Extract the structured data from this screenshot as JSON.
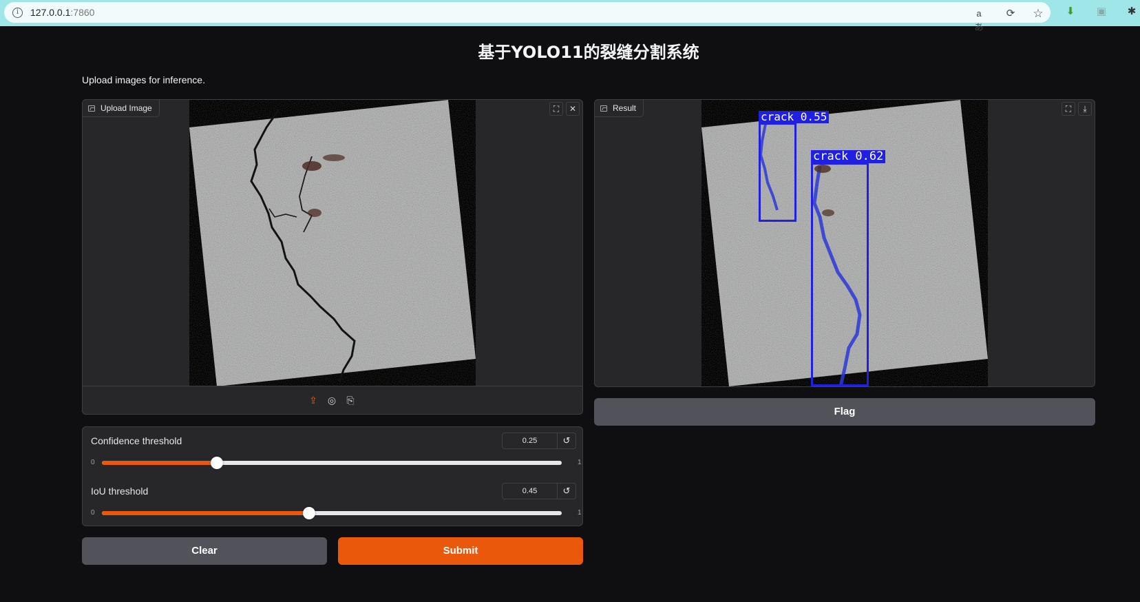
{
  "browser": {
    "url_host": "127.0.0.1",
    "url_port": ":7860",
    "icons": [
      "read-aloud-icon",
      "refresh-icon",
      "favorite-star-icon",
      "extension-download-icon",
      "extension-screen-icon",
      "extensions-puzzle-icon"
    ]
  },
  "page": {
    "title": "基于YOLO11的裂缝分割系统",
    "description": "Upload images for inference."
  },
  "upload": {
    "label": "Upload Image",
    "sources": [
      "upload-icon",
      "webcam-icon",
      "clipboard-icon"
    ]
  },
  "result": {
    "label": "Result",
    "detections": [
      {
        "label": "crack 0.55"
      },
      {
        "label": "crack 0.62"
      }
    ]
  },
  "sliders": [
    {
      "label": "Confidence threshold",
      "value": "0.25",
      "min": "0",
      "max": "1",
      "fraction": 0.25
    },
    {
      "label": "IoU threshold",
      "value": "0.45",
      "min": "0",
      "max": "1",
      "fraction": 0.45
    }
  ],
  "buttons": {
    "clear": "Clear",
    "submit": "Submit",
    "flag": "Flag"
  },
  "colors": {
    "accent": "#ea580c",
    "detection_box": "#2020e0"
  }
}
